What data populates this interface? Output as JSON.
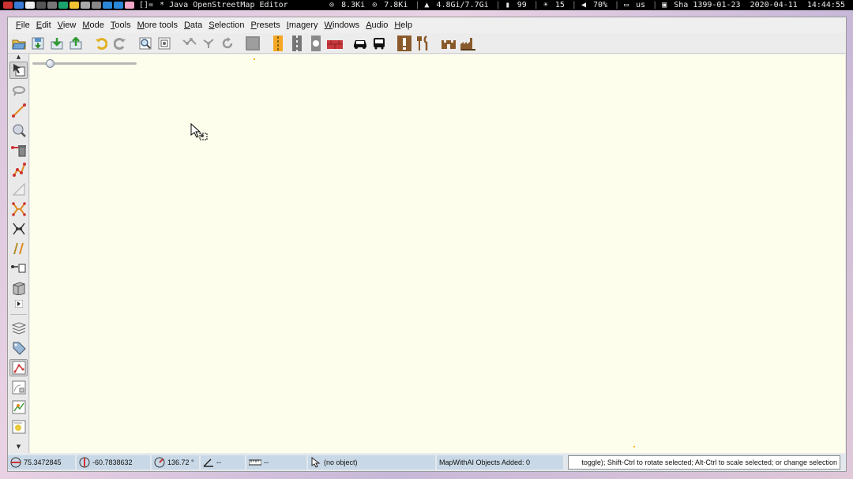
{
  "system_bar": {
    "layout_indicator": "[]=",
    "window_title": "* Java OpenStreetMap Editor",
    "net_down": "8.3Ki",
    "net_up": "7.8Ki",
    "memory": "4.8Gi/7.7Gi",
    "battery_percent": "99",
    "brightness": "15",
    "volume": "70%",
    "keyboard_layout": "us",
    "date_persian": "Sha 1399-01-23",
    "date": "2020-04-11",
    "time": "14:44:55"
  },
  "menubar": [
    {
      "mnemonic": "F",
      "rest": "ile"
    },
    {
      "mnemonic": "E",
      "rest": "dit"
    },
    {
      "mnemonic": "V",
      "rest": "iew"
    },
    {
      "mnemonic": "M",
      "rest": "ode"
    },
    {
      "mnemonic": "T",
      "rest": "ools"
    },
    {
      "mnemonic": "M",
      "rest": "ore tools"
    },
    {
      "mnemonic": "D",
      "rest": "ata"
    },
    {
      "mnemonic": "S",
      "rest": "election"
    },
    {
      "mnemonic": "P",
      "rest": "resets"
    },
    {
      "mnemonic": "I",
      "rest": "magery"
    },
    {
      "mnemonic": "W",
      "rest": "indows"
    },
    {
      "mnemonic": "A",
      "rest": "udio"
    },
    {
      "mnemonic": "H",
      "rest": "elp"
    }
  ],
  "toolbar_icons": [
    "open-icon",
    "save-icon",
    "download-icon",
    "upload-icon",
    "undo-icon",
    "redo-icon",
    "zoom-preferences-icon",
    "layers-icon",
    "merge-nodes-icon",
    "split-way-icon",
    "refresh-icon",
    "gray-square-icon",
    "road-icon",
    "railway-icon",
    "traffic-light-icon",
    "wall-icon",
    "car-icon",
    "bus-icon",
    "info-board-icon",
    "restaurant-icon",
    "castle-icon",
    "factory-icon"
  ],
  "left_tools": [
    "select-icon",
    "lasso-icon",
    "draw-icon",
    "zoom-icon",
    "delete-icon",
    "improve-way-icon",
    "parallel-icon",
    "split-icon",
    "join-icon",
    "paint-icon",
    "extrude-icon",
    "building-icon",
    "expand-icon",
    "layer-list-icon",
    "tag-icon",
    "selection-list-icon",
    "relation-icon",
    "map-icon",
    "notes-icon"
  ],
  "status_bar": {
    "latitude": "75.3472845",
    "longitude": "-60.7838632",
    "heading": "136.72 °",
    "angle": "--",
    "distance": "--",
    "object": "(no object)",
    "mapwithai": "MapWithAI Objects Added: 0",
    "help_text": "toggle); Shift-Ctrl to rotate selected; Alt-Ctrl to scale selected; or change selection"
  },
  "colors": {
    "map_background": "#fefeec",
    "status_cell": "#c8d8e6",
    "orange_dot": "#ffb000"
  }
}
